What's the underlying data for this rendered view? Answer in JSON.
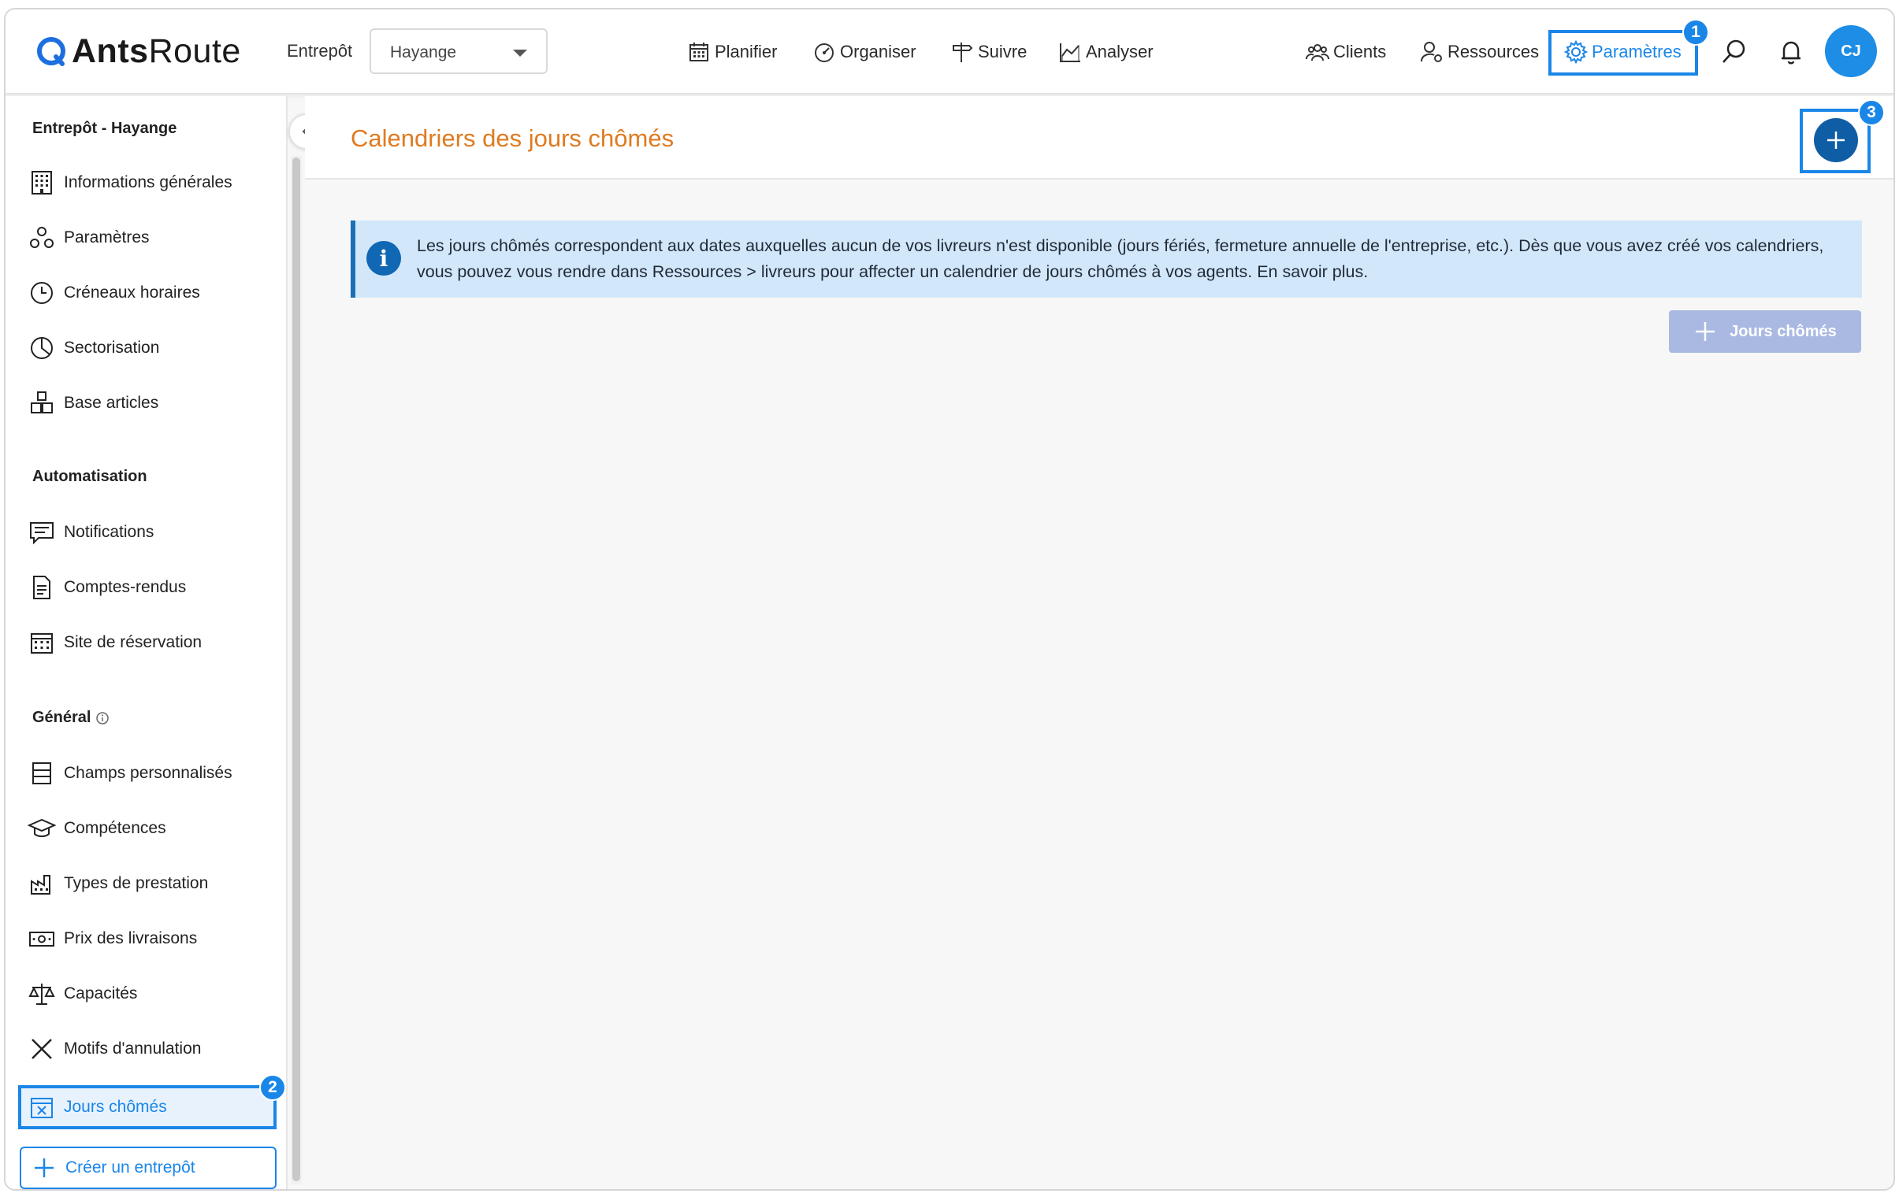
{
  "brand": {
    "name_bold": "Ants",
    "name_regular": "Route"
  },
  "header": {
    "depot_label": "Entrepôt",
    "depot_selected": "Hayange",
    "nav": {
      "plan": "Planifier",
      "organize": "Organiser",
      "track": "Suivre",
      "analyze": "Analyser",
      "clients": "Clients",
      "resources": "Ressources",
      "settings": "Paramètres"
    },
    "avatar_initials": "CJ"
  },
  "badges": {
    "one": "1",
    "two": "2",
    "three": "3"
  },
  "sidebar": {
    "section_depot": "Entrepôt - Hayange",
    "section_auto": "Automatisation",
    "section_general": "Général",
    "items": {
      "info": "Informations générales",
      "params": "Paramètres",
      "slots": "Créneaux horaires",
      "sector": "Sectorisation",
      "articles": "Base articles",
      "notifications": "Notifications",
      "reports": "Comptes-rendus",
      "booking": "Site de réservation",
      "fields": "Champs personnalisés",
      "skills": "Compétences",
      "services": "Types de prestation",
      "prices": "Prix des livraisons",
      "capacities": "Capacités",
      "cancel": "Motifs d'annulation",
      "holidays": "Jours chômés"
    },
    "create_depot": "Créer un entrepôt"
  },
  "main": {
    "title": "Calendriers des jours chômés",
    "info_text": "Les jours chômés correspondent aux dates auxquelles aucun de vos livreurs n'est disponible (jours fériés, fermeture annuelle de l'entreprise, etc.). Dès que vous avez créé vos calendriers, vous pouvez vous rendre dans Ressources > livreurs pour affecter un calendrier de jours chômés à vos agents. En savoir plus.",
    "add_holidays_button": "Jours chômés"
  },
  "colors": {
    "accent": "#1a86e8",
    "title": "#e07a1f",
    "add_button": "#0f5ea5",
    "banner": "#d3e7fb",
    "disabled_button": "#a9b9e2"
  }
}
